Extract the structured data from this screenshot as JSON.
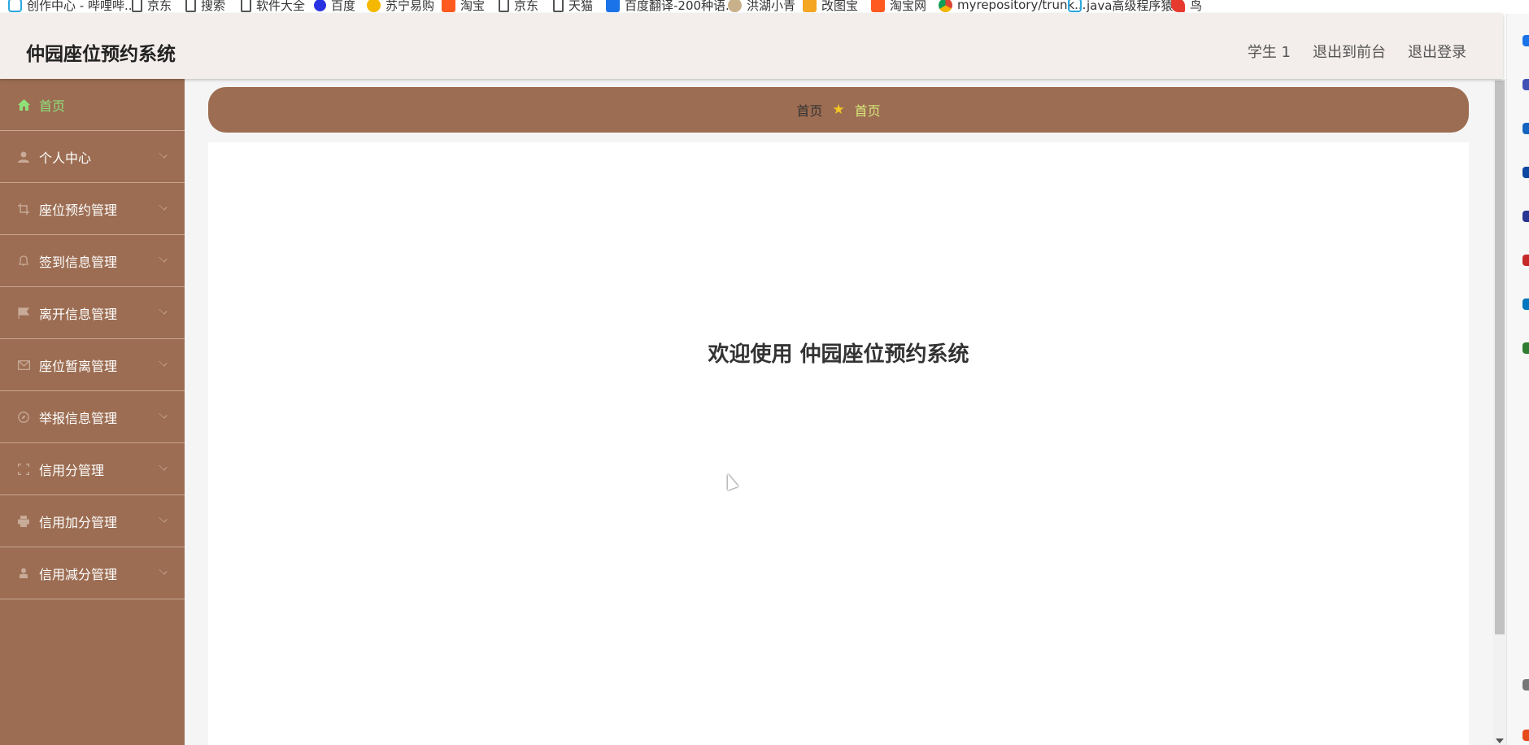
{
  "bookmarks": [
    {
      "label": "创作中心 - 哔哩哔...",
      "icon": "bilibili-icon"
    },
    {
      "label": "京东",
      "icon": "page-icon"
    },
    {
      "label": "搜索",
      "icon": "page-icon"
    },
    {
      "label": "软件大全",
      "icon": "page-icon"
    },
    {
      "label": "百度",
      "icon": "baidu-icon"
    },
    {
      "label": "苏宁易购",
      "icon": "suning-icon"
    },
    {
      "label": "淘宝",
      "icon": "taobao-icon"
    },
    {
      "label": "京东",
      "icon": "page-icon"
    },
    {
      "label": "天猫",
      "icon": "page-icon"
    },
    {
      "label": "百度翻译-200种语...",
      "icon": "fanyi-icon"
    },
    {
      "label": "洪湖小青",
      "icon": "honghu-icon"
    },
    {
      "label": "改图宝",
      "icon": "gaitubao-icon"
    },
    {
      "label": "淘宝网",
      "icon": "taobao-icon"
    },
    {
      "label": "myrepository/trunk...",
      "icon": "chrome-icon"
    },
    {
      "label": "java高级程序猿",
      "icon": "bilibili-icon"
    },
    {
      "label": "鸟",
      "icon": "niao-icon"
    }
  ],
  "header": {
    "title": "仲园座位预约系统",
    "user": "学生 1",
    "to_front": "退出到前台",
    "logout": "退出登录"
  },
  "sidebar": {
    "items": [
      {
        "label": "首页",
        "icon": "home-icon",
        "active": true
      },
      {
        "label": "个人中心",
        "icon": "user-icon"
      },
      {
        "label": "座位预约管理",
        "icon": "crop-icon"
      },
      {
        "label": "签到信息管理",
        "icon": "bell-icon"
      },
      {
        "label": "离开信息管理",
        "icon": "flag-icon"
      },
      {
        "label": "座位暂离管理",
        "icon": "mail-icon"
      },
      {
        "label": "举报信息管理",
        "icon": "compass-icon"
      },
      {
        "label": "信用分管理",
        "icon": "fullscreen-icon"
      },
      {
        "label": "信用加分管理",
        "icon": "printer-icon"
      },
      {
        "label": "信用减分管理",
        "icon": "person-icon"
      }
    ]
  },
  "breadcrumb": {
    "home": "首页",
    "current": "首页"
  },
  "main": {
    "welcome": "欢迎使用 仲园座位预约系统"
  },
  "colors": {
    "sidebar_bg": "#9c6d52",
    "header_bg": "#f3edeb",
    "active_green": "#8ee07a",
    "star": "#f3c623"
  }
}
